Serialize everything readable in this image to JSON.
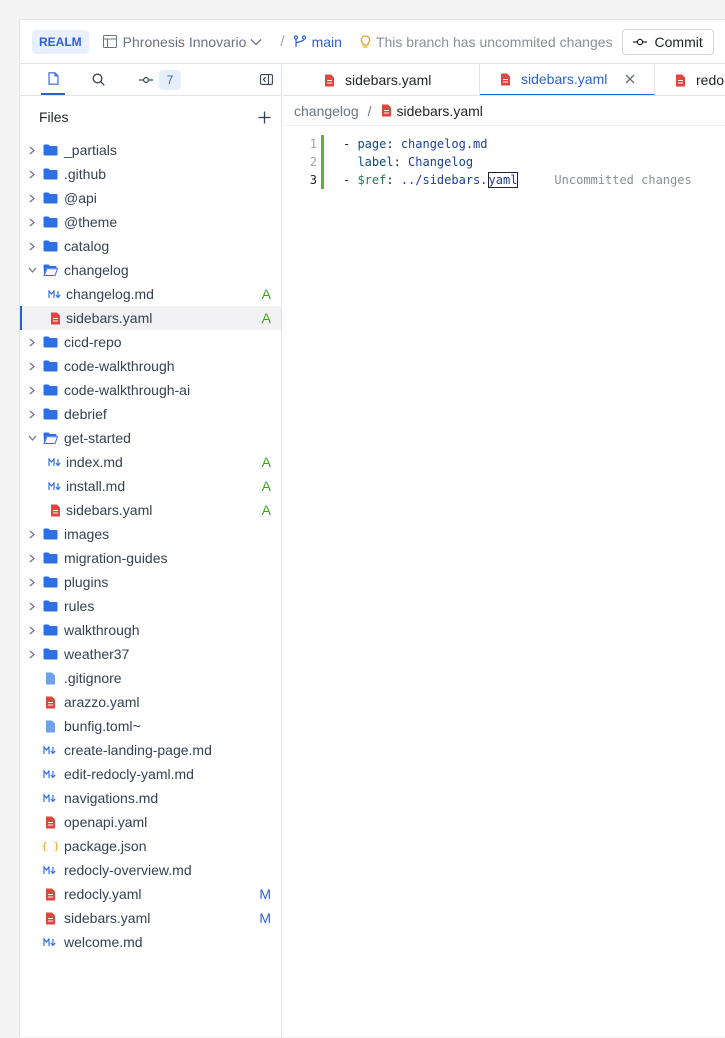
{
  "header": {
    "realm": "REALM",
    "project": "Phronesis Innovario",
    "separator": "/",
    "branch": "main",
    "notice": "This branch has uncommited changes",
    "commit_label": "Commit"
  },
  "sidebar": {
    "changes_count": "7",
    "files_title": "Files",
    "tree": [
      {
        "label": "_partials",
        "type": "folder",
        "depth": 0,
        "expanded": false
      },
      {
        "label": ".github",
        "type": "folder",
        "depth": 0,
        "expanded": false
      },
      {
        "label": "@api",
        "type": "folder",
        "depth": 0,
        "expanded": false
      },
      {
        "label": "@theme",
        "type": "folder",
        "depth": 0,
        "expanded": false
      },
      {
        "label": "catalog",
        "type": "folder",
        "depth": 0,
        "expanded": false
      },
      {
        "label": "changelog",
        "type": "folder",
        "depth": 0,
        "expanded": true
      },
      {
        "label": "changelog.md",
        "type": "md",
        "depth": 1,
        "status": "A"
      },
      {
        "label": "sidebars.yaml",
        "type": "yaml",
        "depth": 1,
        "status": "A",
        "selected": true
      },
      {
        "label": "cicd-repo",
        "type": "folder",
        "depth": 0,
        "expanded": false
      },
      {
        "label": "code-walkthrough",
        "type": "folder",
        "depth": 0,
        "expanded": false
      },
      {
        "label": "code-walkthrough-ai",
        "type": "folder",
        "depth": 0,
        "expanded": false
      },
      {
        "label": "debrief",
        "type": "folder",
        "depth": 0,
        "expanded": false
      },
      {
        "label": "get-started",
        "type": "folder",
        "depth": 0,
        "expanded": true
      },
      {
        "label": "index.md",
        "type": "md",
        "depth": 1,
        "status": "A"
      },
      {
        "label": "install.md",
        "type": "md",
        "depth": 1,
        "status": "A"
      },
      {
        "label": "sidebars.yaml",
        "type": "yaml",
        "depth": 1,
        "status": "A"
      },
      {
        "label": "images",
        "type": "folder",
        "depth": 0,
        "expanded": false
      },
      {
        "label": "migration-guides",
        "type": "folder",
        "depth": 0,
        "expanded": false
      },
      {
        "label": "plugins",
        "type": "folder",
        "depth": 0,
        "expanded": false
      },
      {
        "label": "rules",
        "type": "folder",
        "depth": 0,
        "expanded": false
      },
      {
        "label": "walkthrough",
        "type": "folder",
        "depth": 0,
        "expanded": false
      },
      {
        "label": "weather37",
        "type": "folder",
        "depth": 0,
        "expanded": false
      },
      {
        "label": ".gitignore",
        "type": "file",
        "depth": 0
      },
      {
        "label": "arazzo.yaml",
        "type": "yaml",
        "depth": 0
      },
      {
        "label": "bunfig.toml~",
        "type": "file",
        "depth": 0
      },
      {
        "label": "create-landing-page.md",
        "type": "md",
        "depth": 0
      },
      {
        "label": "edit-redocly-yaml.md",
        "type": "md",
        "depth": 0
      },
      {
        "label": "navigations.md",
        "type": "md",
        "depth": 0
      },
      {
        "label": "openapi.yaml",
        "type": "yaml",
        "depth": 0
      },
      {
        "label": "package.json",
        "type": "json",
        "depth": 0
      },
      {
        "label": "redocly-overview.md",
        "type": "md",
        "depth": 0
      },
      {
        "label": "redocly.yaml",
        "type": "yaml",
        "depth": 0,
        "status": "M"
      },
      {
        "label": "sidebars.yaml",
        "type": "yaml",
        "depth": 0,
        "status": "M"
      },
      {
        "label": "welcome.md",
        "type": "md",
        "depth": 0
      }
    ]
  },
  "editor": {
    "tabs": [
      {
        "label": "sidebars.yaml",
        "active": false
      },
      {
        "label": "sidebars.yaml",
        "active": true
      },
      {
        "label": "redo",
        "active": false
      }
    ],
    "breadcrumb": {
      "folder": "changelog",
      "separator": "/",
      "file": "sidebars.yaml"
    },
    "lines": [
      {
        "num": "1",
        "dash": "- ",
        "key": "page",
        "colon": ": ",
        "value": "changelog.md"
      },
      {
        "num": "2",
        "dash": "  ",
        "key": "label",
        "colon": ": ",
        "value": "Changelog"
      },
      {
        "num": "3",
        "dash": "- ",
        "key": "$ref",
        "colon": ": ",
        "value": "../sidebars.",
        "value_cursor": "yaml",
        "hint": "Uncommitted changes"
      }
    ]
  },
  "colors": {
    "accent": "#2b5fd9",
    "added": "#3fa21b",
    "folder": "#2f6fe4",
    "yaml_icon": "#e0463f",
    "json_icon": "#e3a21a",
    "gutter_change": "#5fb236"
  }
}
